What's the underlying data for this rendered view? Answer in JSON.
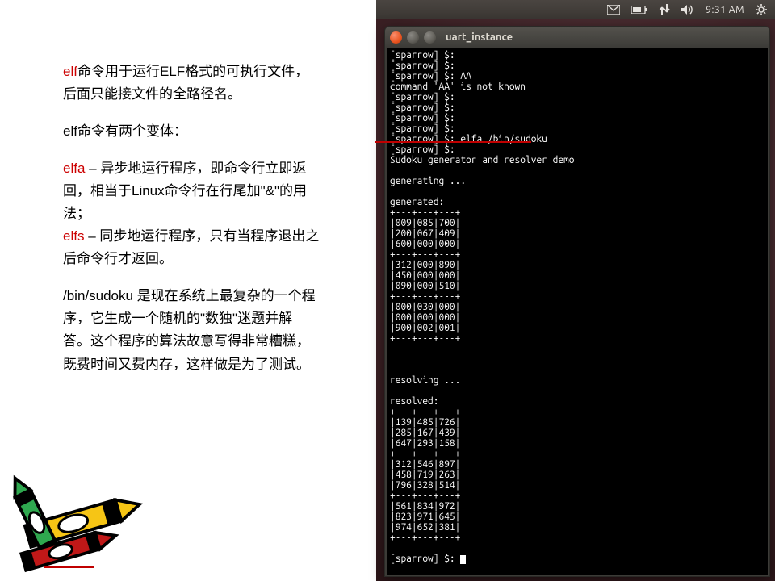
{
  "doc": {
    "p1a": "elf",
    "p1b": "命令用于运行ELF格式的可执行文件，后面只能接文件的全路径名。",
    "p2": "elf命令有两个变体：",
    "p3a": "elfa",
    "p3b": " – 异步地运行程序，即命令行立即返回，相当于Linux命令行在行尾加\"&\"的用法；",
    "p4a": "elfs",
    "p4b": " – 同步地运行程序，只有当程序退出之后命令行才返回。",
    "p5": "/bin/sudoku 是现在系统上最复杂的一个程序，它生成一个随机的\"数独\"迷题并解答。这个程序的算法故意写得非常糟糕，既费时间又费内存，这样做是为了测试。"
  },
  "menubar": {
    "time": "9:31 AM"
  },
  "terminal": {
    "title": "uart_instance",
    "lines": [
      "[sparrow] $:",
      "[sparrow] $:",
      "[sparrow] $: AA",
      "command 'AA' is not known",
      "[sparrow] $:",
      "[sparrow] $:",
      "[sparrow] $:",
      "[sparrow] $:",
      "[sparrow] $: elfa /bin/sudoku",
      "[sparrow] $:",
      "Sudoku generator and resolver demo",
      "",
      "generating ...",
      "",
      "generated:",
      "+---+---+---+",
      "|009|085|700|",
      "|200|067|409|",
      "|600|000|000|",
      "+---+---+---+",
      "|312|000|890|",
      "|450|000|000|",
      "|090|000|510|",
      "+---+---+---+",
      "|000|030|000|",
      "|000|000|000|",
      "|900|002|001|",
      "+---+---+---+",
      "",
      "",
      "",
      "resolving ...",
      "",
      "resolved:",
      "+---+---+---+",
      "|139|485|726|",
      "|285|167|439|",
      "|647|293|158|",
      "+---+---+---+",
      "|312|546|897|",
      "|458|719|263|",
      "|796|328|514|",
      "+---+---+---+",
      "|561|834|972|",
      "|823|971|645|",
      "|974|652|381|",
      "+---+---+---+",
      ""
    ],
    "last_prompt": "[sparrow] $: "
  }
}
